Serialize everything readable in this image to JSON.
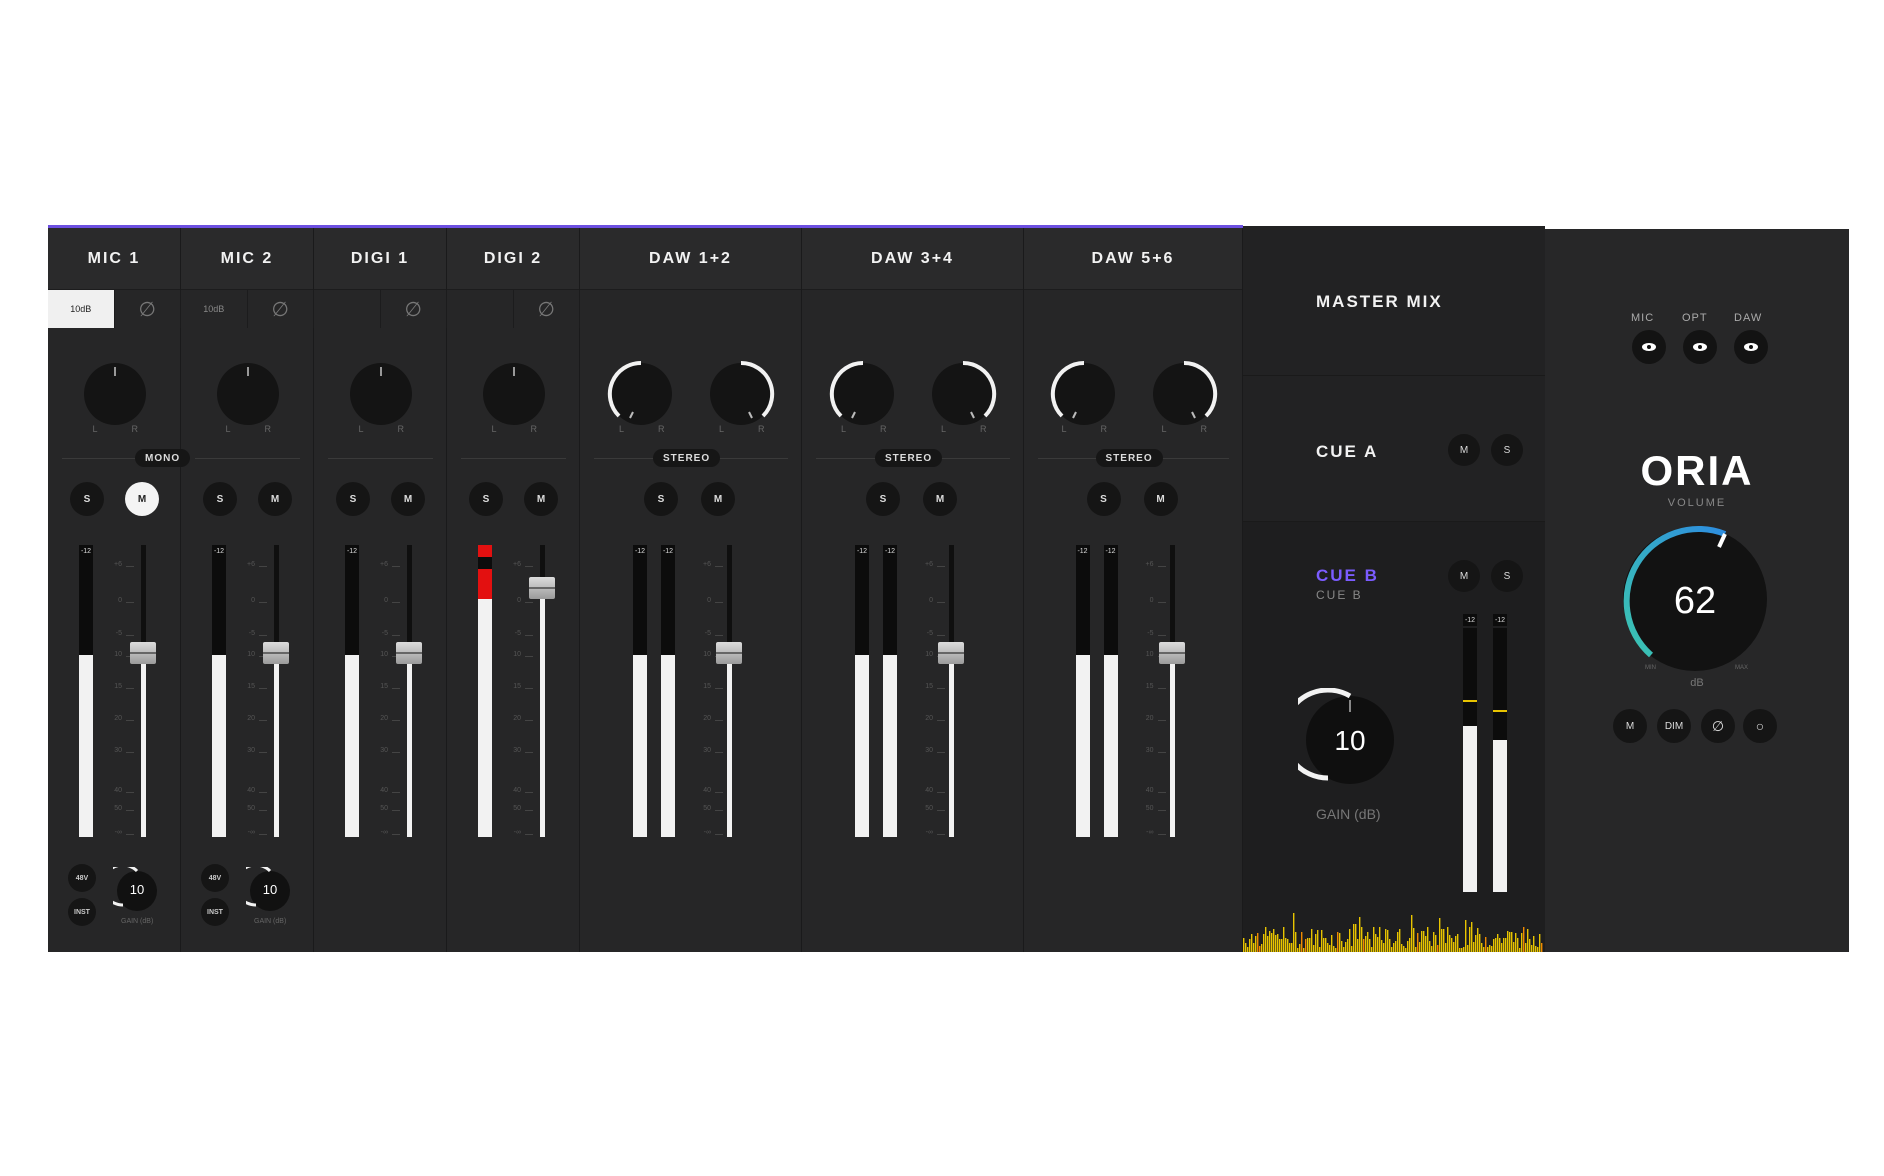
{
  "strips": [
    {
      "name": "MIC 1",
      "mode": "MONO",
      "pad": "10dB",
      "solo": "S",
      "mute": "M",
      "mute_on": true,
      "gain": "10",
      "gain_label": "GAIN (dB)",
      "btn_48v": "48V",
      "btn_inst": "INST",
      "peak": "-12"
    },
    {
      "name": "MIC 2",
      "pad": "10dB",
      "solo": "S",
      "mute": "M",
      "gain": "10",
      "gain_label": "GAIN (dB)",
      "btn_48v": "48V",
      "btn_inst": "INST",
      "peak": "-12"
    },
    {
      "name": "DIGI 1",
      "solo": "S",
      "mute": "M",
      "peak": "-12"
    },
    {
      "name": "DIGI 2",
      "solo": "S",
      "mute": "M"
    },
    {
      "name": "DAW 1+2",
      "mode": "STEREO",
      "solo": "S",
      "mute": "M",
      "peak": "-12"
    },
    {
      "name": "DAW 3+4",
      "mode": "STEREO",
      "solo": "S",
      "mute": "M",
      "peak": "-12"
    },
    {
      "name": "DAW 5+6",
      "mode": "STEREO",
      "solo": "S",
      "mute": "M",
      "peak": "-12"
    }
  ],
  "pan_labels": {
    "l": "L",
    "r": "R"
  },
  "fader_scale": [
    "+6",
    "0",
    "-5",
    "10",
    "15",
    "20",
    "30",
    "40",
    "50",
    "-∞"
  ],
  "master": {
    "title": "MASTER MIX",
    "cue_a": {
      "title": "CUE A",
      "mute": "M",
      "solo": "S"
    },
    "cue_b": {
      "title": "CUE B",
      "subtitle": "CUE B",
      "mute": "M",
      "solo": "S"
    },
    "gain_value": "10",
    "gain_label": "GAIN (dB)",
    "peak": "-12",
    "accent": "#7b5cff"
  },
  "oria": {
    "sources": [
      "MIC",
      "OPT",
      "DAW"
    ],
    "logo": "ORIA",
    "volume_label": "VOLUME",
    "volume_value": "62",
    "volume_unit": "dB",
    "min_label": "MIN",
    "max_label": "MAX",
    "buttons": [
      "M",
      "DIM",
      "∅",
      "○"
    ],
    "arc_color": "#2fb6c4"
  }
}
